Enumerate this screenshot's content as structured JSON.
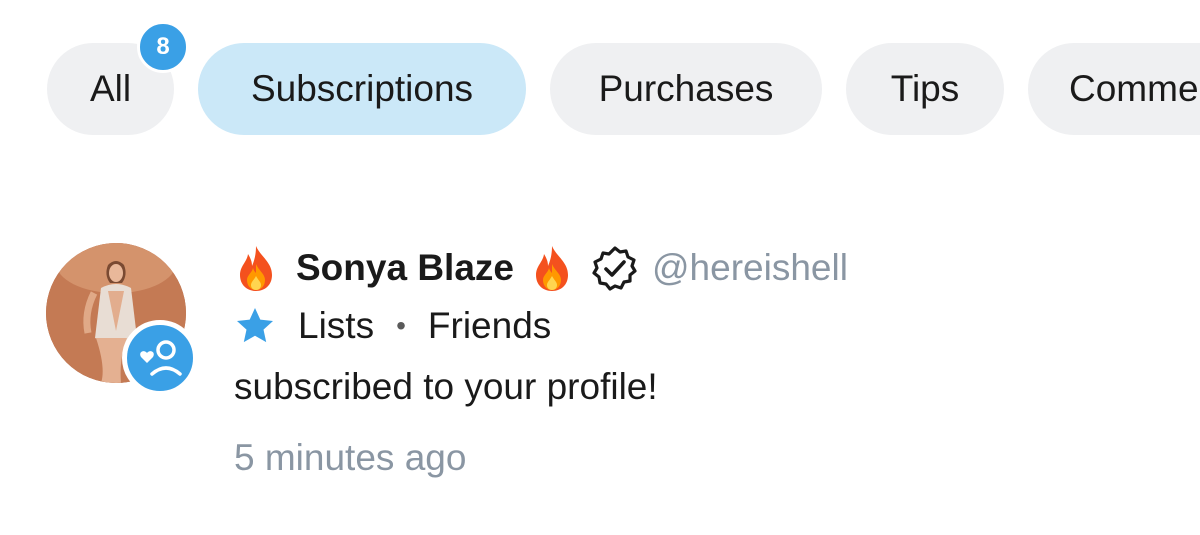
{
  "filters": {
    "all_label": "All",
    "all_badge": "8",
    "subscriptions_label": "Subscriptions",
    "purchases_label": "Purchases",
    "tips_label": "Tips",
    "comments_label": "Comme",
    "active": "Subscriptions"
  },
  "notification": {
    "name": "Sonya Blaze",
    "handle": "@hereishell",
    "list_label": "Lists",
    "list_name": "Friends",
    "message": "subscribed to your profile!",
    "time": "5 minutes ago",
    "leading_emoji": "fire-emoji",
    "trailing_emoji": "fire-emoji",
    "type_icon": "subscriber-icon",
    "verified_icon": "verified-badge-icon",
    "list_icon": "star-icon"
  },
  "colors": {
    "accent": "#3aa0e6",
    "active_tab_bg": "#cbe8f8",
    "tab_bg": "#eff0f2",
    "muted_text": "#8a96a3"
  }
}
